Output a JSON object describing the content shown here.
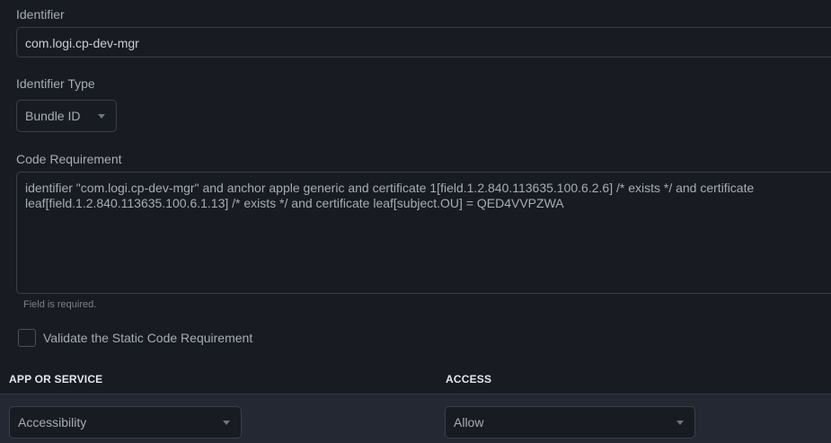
{
  "identifier": {
    "label": "Identifier",
    "value": "com.logi.cp-dev-mgr"
  },
  "identifier_type": {
    "label": "Identifier Type",
    "selected": "Bundle ID"
  },
  "code_requirement": {
    "label": "Code Requirement",
    "value": "identifier \"com.logi.cp-dev-mgr\" and anchor apple generic and certificate 1[field.1.2.840.113635.100.6.2.6] /* exists */ and certificate leaf[field.1.2.840.113635.100.6.1.13] /* exists */ and certificate leaf[subject.OU] = QED4VVPZWA",
    "helper": "Field is required."
  },
  "validate_static": {
    "label": "Validate the Static Code Requirement",
    "checked": false
  },
  "table": {
    "headers": {
      "app_or_service": "APP OR SERVICE",
      "access": "ACCESS"
    },
    "rows": [
      {
        "app_or_service": "Accessibility",
        "access": "Allow"
      }
    ]
  },
  "colors": {
    "background": "#181b22",
    "row_background": "#242833",
    "border": "#3a3f4a"
  }
}
